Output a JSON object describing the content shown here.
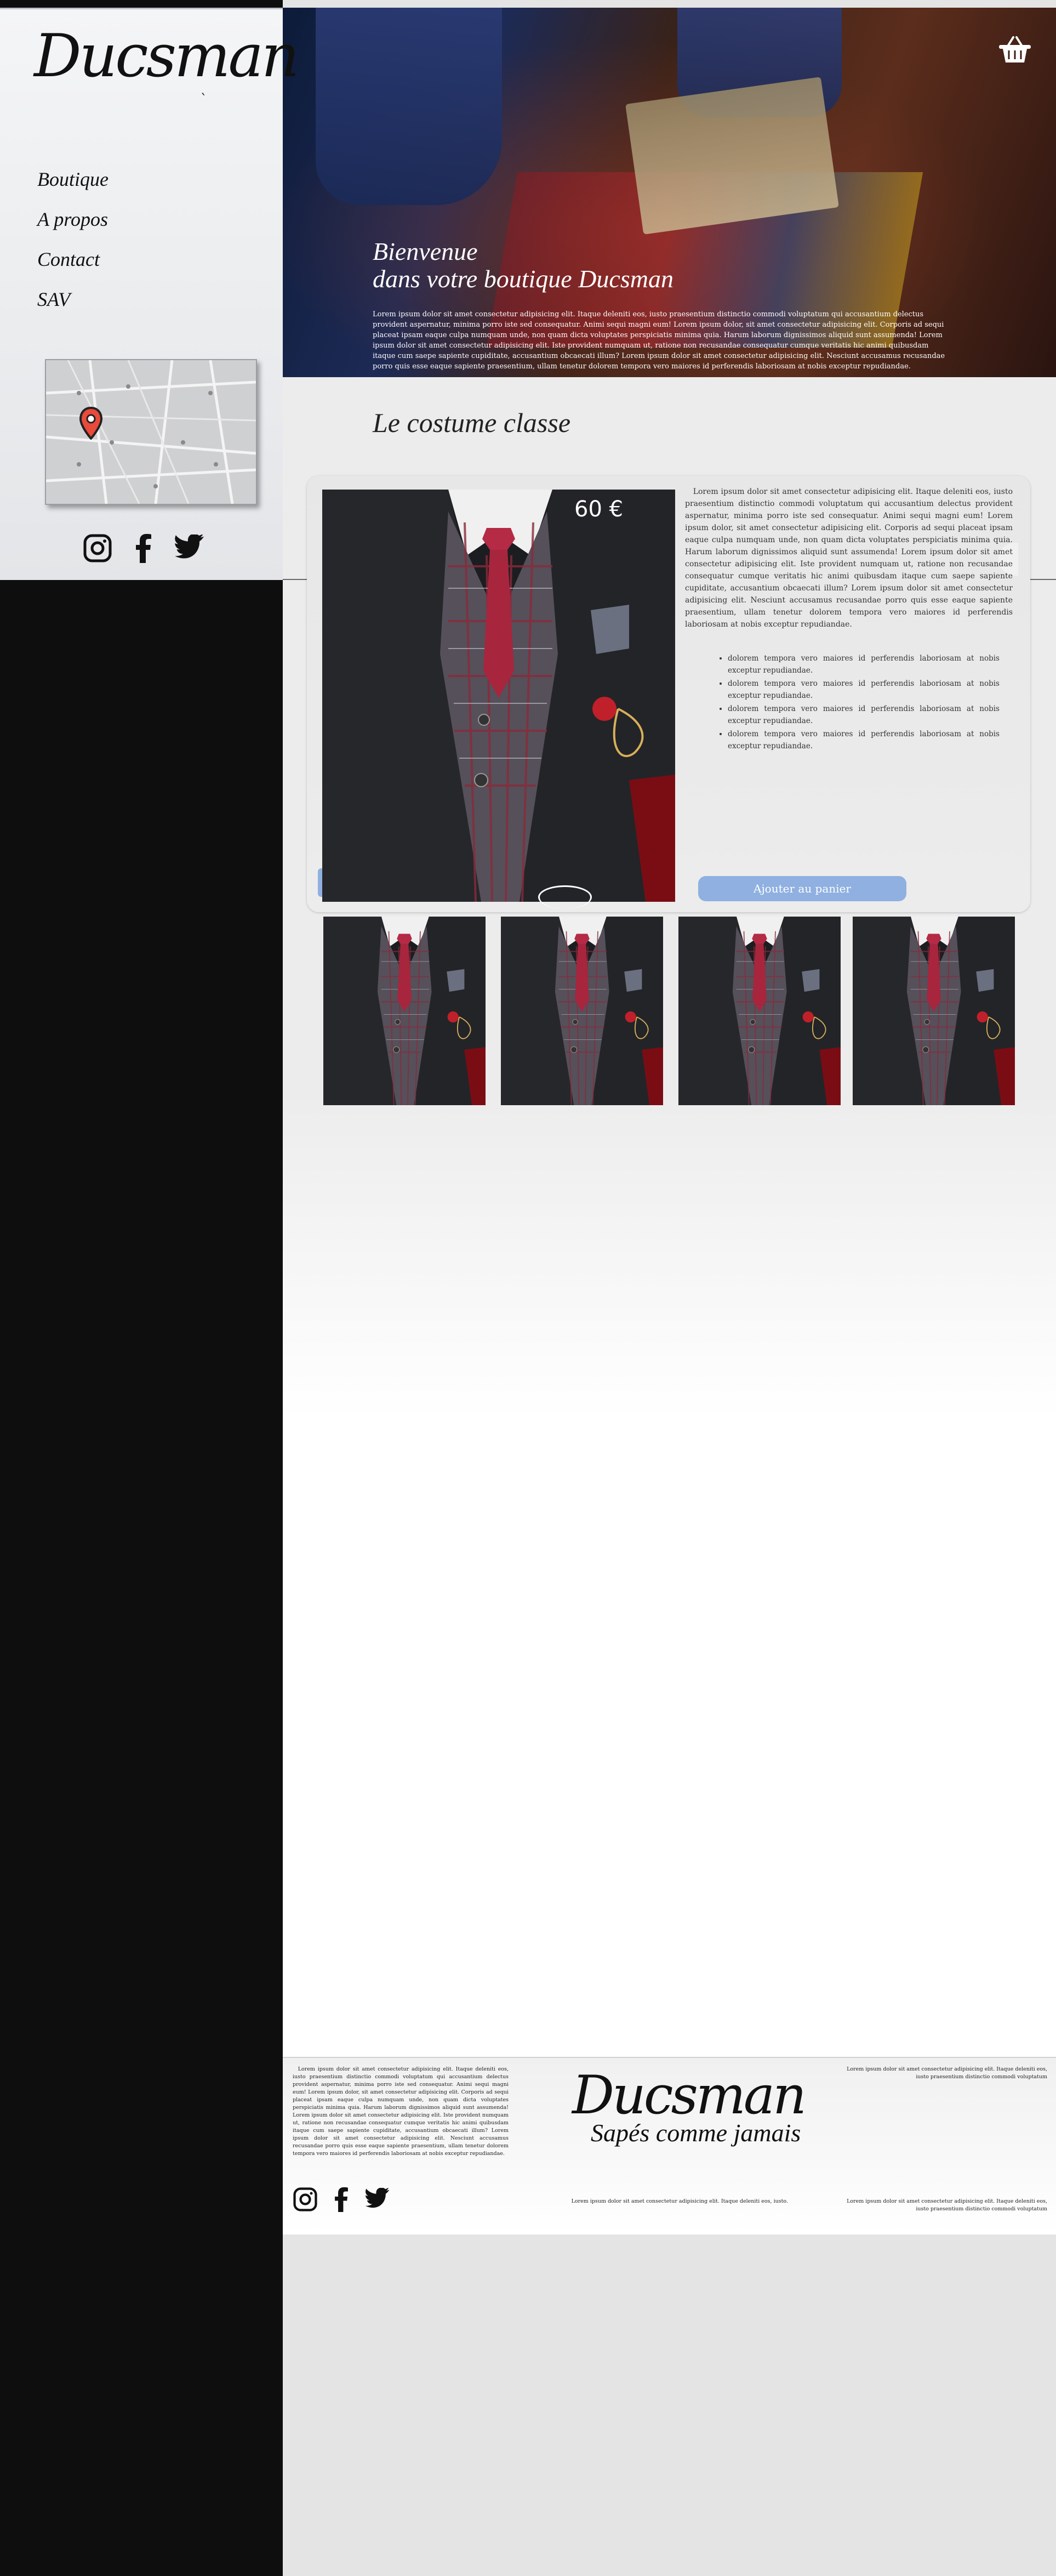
{
  "sidebar": {
    "logo": "Ducsman",
    "nav": [
      "Boutique",
      "A propos",
      "Contact",
      "SAV"
    ]
  },
  "icons": {
    "basket": "basket-icon",
    "instagram": "instagram-icon",
    "facebook": "facebook-icon",
    "twitter": "twitter-icon",
    "map_pin": "map-pin-icon"
  },
  "hero": {
    "title_line1": "Bienvenue",
    "title_line2": "dans votre boutique Ducsman",
    "text": "Lorem ipsum dolor sit amet consectetur adipisicing elit. Itaque deleniti eos, iusto praesentium distinctio commodi voluptatum qui accusantium delectus provident aspernatur, minima porro iste sed consequatur. Animi sequi magni eum! Lorem ipsum dolor, sit amet consectetur adipisicing elit. Corporis ad sequi placeat ipsam eaque culpa numquam unde, non quam dicta voluptates perspiciatis minima quia. Harum laborum dignissimos aliquid sunt assumenda! Lorem ipsum dolor sit amet consectetur adipisicing elit. Iste provident numquam ut, ratione non recusandae consequatur cumque veritatis hic animi quibusdam itaque cum saepe sapiente cupiditate, accusantium obcaecati illum? Lorem ipsum dolor sit amet consectetur adipisicing elit. Nesciunt accusamus recusandae porro quis esse eaque sapiente praesentium, ullam tenetur dolorem tempora vero maiores id perferendis laboriosam at nobis exceptur repudiandae."
  },
  "product": {
    "section_title": "Le costume classe",
    "price": "60 €",
    "description": "Lorem ipsum dolor sit amet consectetur adipisicing elit. Itaque deleniti eos, iusto praesentium distinctio commodi voluptatum qui accusantium delectus provident aspernatur, minima porro iste sed consequatur. Animi sequi magni eum! Lorem ipsum dolor, sit amet consectetur adipisicing elit. Corporis ad sequi placeat ipsam eaque culpa numquam unde, non quam dicta voluptates perspiciatis minima quia. Harum laborum dignissimos aliquid sunt assumenda! Lorem ipsum dolor sit amet consectetur adipisicing elit. Iste provident numquam ut, ratione non recusandae consequatur cumque veritatis hic animi quibusdam itaque cum saepe sapiente cupiditate, accusantium obcaecati illum? Lorem ipsum dolor sit amet consectetur adipisicing elit. Nesciunt accusamus recusandae porro quis esse eaque sapiente praesentium, ullam tenetur dolorem tempora vero maiores id perferendis laboriosam at nobis exceptur repudiandae.",
    "bullets": [
      "dolorem tempora vero maiores id perferendis laboriosam at nobis exceptur repudiandae.",
      "dolorem tempora vero maiores id perferendis laboriosam at nobis exceptur repudiandae.",
      "dolorem tempora vero maiores id perferendis laboriosam at nobis exceptur repudiandae.",
      "dolorem tempora vero maiores id perferendis laboriosam at nobis exceptur repudiandae."
    ],
    "add_to_cart": "Ajouter au panier"
  },
  "footer": {
    "left_text": "Lorem ipsum dolor sit amet consectetur adipisicing elit. Itaque deleniti eos, iusto praesentium distinctio commodi voluptatum qui accusantium delectus provident aspernatur, minima porro iste sed consequatur. Animi sequi magni eum! Lorem ipsum dolor, sit amet consectetur adipisicing elit. Corporis ad sequi placeat ipsam eaque culpa numquam unde, non quam dicta voluptates perspiciatis minima quia. Harum laborum dignissimos aliquid sunt assumenda! Lorem ipsum dolor sit amet consectetur adipisicing elit. Iste provident numquam ut, ratione non recusandae consequatur cumque veritatis hic animi quibusdam itaque cum saepe sapiente cupiditate, accusantium obcaecati illum? Lorem ipsum dolor sit amet consectetur adipisicing elit. Nesciunt accusamus recusandae porro quis esse eaque sapiente praesentium, ullam tenetur dolorem tempora vero maiores id perferendis laboriosam at nobis exceptur repudiandae.",
    "logo": "Ducsman",
    "tagline": "Sapés comme jamais",
    "top_right_text": "Lorem ipsum dolor sit amet consectetur adipisicing elit. Itaque deleniti eos, iusto praesentium distinctio commodi voluptatum",
    "bottom_center_text": "Lorem ipsum dolor sit amet consectetur adipisicing elit. Itaque deleniti eos, iusto.",
    "bottom_right_text": "Lorem ipsum dolor sit amet consectetur adipisicing elit. Itaque deleniti eos, iusto praesentium distinctio commodi voluptatum"
  },
  "colors": {
    "accent_button": "#8fb0e0",
    "sidebar_bg": "#f0f1f3",
    "page_left": "#0e0e0e"
  }
}
